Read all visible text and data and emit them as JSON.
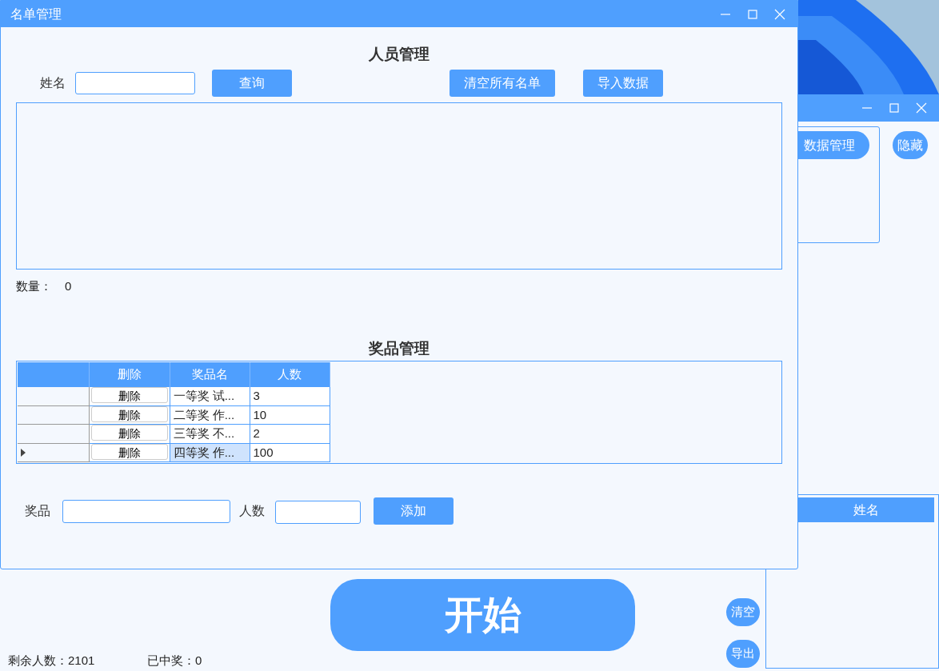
{
  "back_window": {
    "buttons": [
      {
        "label": "数据管理"
      },
      {
        "label": "隐藏"
      }
    ],
    "list_columns": [
      "姓名"
    ],
    "start_button": "开始",
    "side_buttons": [
      "清空",
      "导出"
    ],
    "status": [
      {
        "label": "剩余人数：",
        "value": "2101"
      },
      {
        "label": "已中奖：",
        "value": "0"
      }
    ]
  },
  "window": {
    "title": "名单管理"
  },
  "person_section": {
    "title": "人员管理",
    "name_label": "姓名",
    "search_button": "查询",
    "clear_button": "清空所有名单",
    "import_button": "导入数据",
    "count_label": "数量：",
    "count": "0"
  },
  "prize_section": {
    "title": "奖品管理",
    "columns": [
      "删除",
      "奖品名",
      "人数"
    ],
    "rows": [
      {
        "delete": "删除",
        "name": "一等奖 试...",
        "count": "3",
        "selected": false
      },
      {
        "delete": "删除",
        "name": "二等奖 作...",
        "count": "10",
        "selected": false
      },
      {
        "delete": "删除",
        "name": "三等奖 不...",
        "count": "2",
        "selected": false
      },
      {
        "delete": "删除",
        "name": "四等奖 作...",
        "count": "100",
        "selected": true
      }
    ],
    "prize_label": "奖品",
    "count_label": "人数",
    "add_button": "添加"
  }
}
